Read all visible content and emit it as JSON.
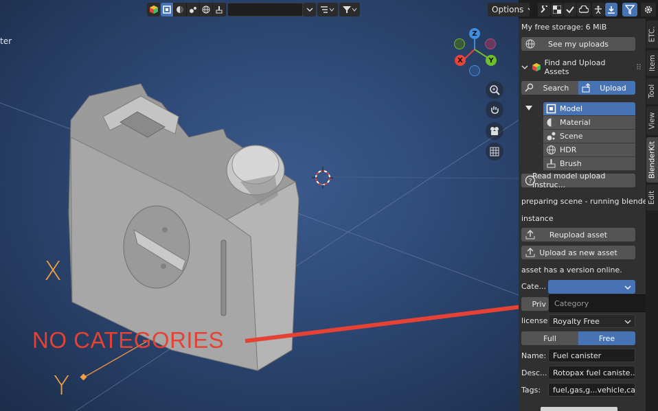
{
  "header": {
    "options_label": "Options",
    "search_value": ""
  },
  "viewport": {
    "clipped_label": "ter",
    "gizmo": {
      "x": "X",
      "y": "Y",
      "z": "Z"
    },
    "axis_x_label": "X",
    "axis_y_label": "Y"
  },
  "annotation": {
    "text": "NO CATEGORIES",
    "color": "#e34234"
  },
  "sidebar": {
    "storage": "My free storage: 6 MiB",
    "see_uploads": "See my uploads",
    "panel_title": "Find and Upload Assets",
    "search_tab": "Search",
    "upload_tab": "Upload",
    "asset_types": [
      "Model",
      "Material",
      "Scene",
      "HDR",
      "Brush"
    ],
    "read_instructions": "Read model upload instruc...",
    "status_line1": "preparing scene - running blender",
    "status_line2": "instance",
    "reupload": "Reupload asset",
    "upload_new": "Upload as new asset",
    "version_note": "asset has a version online.",
    "category_label": "Cate...",
    "category_value": "",
    "category_popup": "Category",
    "private_label": "Priv",
    "license_label": "license:",
    "license_value": "Royalty Free",
    "full_label": "Full",
    "free_label": "Free",
    "name_label": "Name:",
    "name_value": "Fuel canister",
    "desc_label": "Desc...",
    "desc_value": "Rotopax fuel caniste...",
    "tags_label": "Tags:",
    "tags_value": "fuel,gas,g...vehicle,car"
  },
  "tabs": [
    "ETC.",
    "Item",
    "Tool",
    "View",
    "BlenderKit",
    "Edit"
  ],
  "active_tab": "BlenderKit",
  "colors": {
    "accent": "#4772b3",
    "x_axis": "#e8443a",
    "y_axis": "#6fbf2a",
    "z_axis": "#3f8fe0"
  }
}
